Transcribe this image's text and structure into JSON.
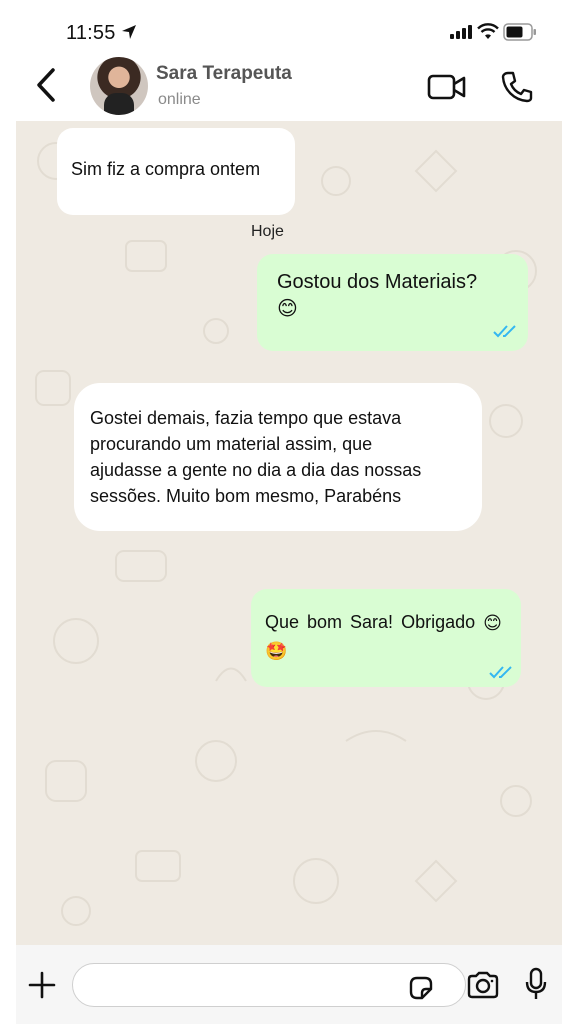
{
  "status_bar": {
    "time": "11:55"
  },
  "header": {
    "contact_name": "Sara Terapeuta",
    "presence": "online"
  },
  "chat": {
    "date_separator": "Hoje",
    "messages": [
      {
        "direction": "incoming",
        "text": "Sim fiz a compra ontem"
      },
      {
        "direction": "outgoing",
        "text": "Gostou dos Materiais?",
        "emoji": "😊",
        "read": true
      },
      {
        "direction": "incoming",
        "lines": [
          "Gostei demais, fazia tempo que estava",
          "procurando um material assim, que",
          "ajudasse a gente no dia a dia das nossas",
          "sessões. Muito bom mesmo, Parabéns"
        ]
      },
      {
        "direction": "outgoing",
        "text": "Que bom Sara! Obrigado",
        "emoji": "😊",
        "emoji2": "🤩",
        "read": true
      }
    ]
  },
  "input": {
    "value": "",
    "placeholder": ""
  },
  "colors": {
    "chat_bg": "#efeae2",
    "outgoing_bubble": "#d9fdd3",
    "incoming_bubble": "#ffffff",
    "read_ticks": "#34b7f1"
  },
  "icons": [
    "location-arrow-icon",
    "signal-icon",
    "wifi-icon",
    "battery-icon",
    "back-chevron-icon",
    "video-call-icon",
    "phone-call-icon",
    "plus-icon",
    "sticker-icon",
    "camera-icon",
    "microphone-icon",
    "read-ticks-icon"
  ]
}
